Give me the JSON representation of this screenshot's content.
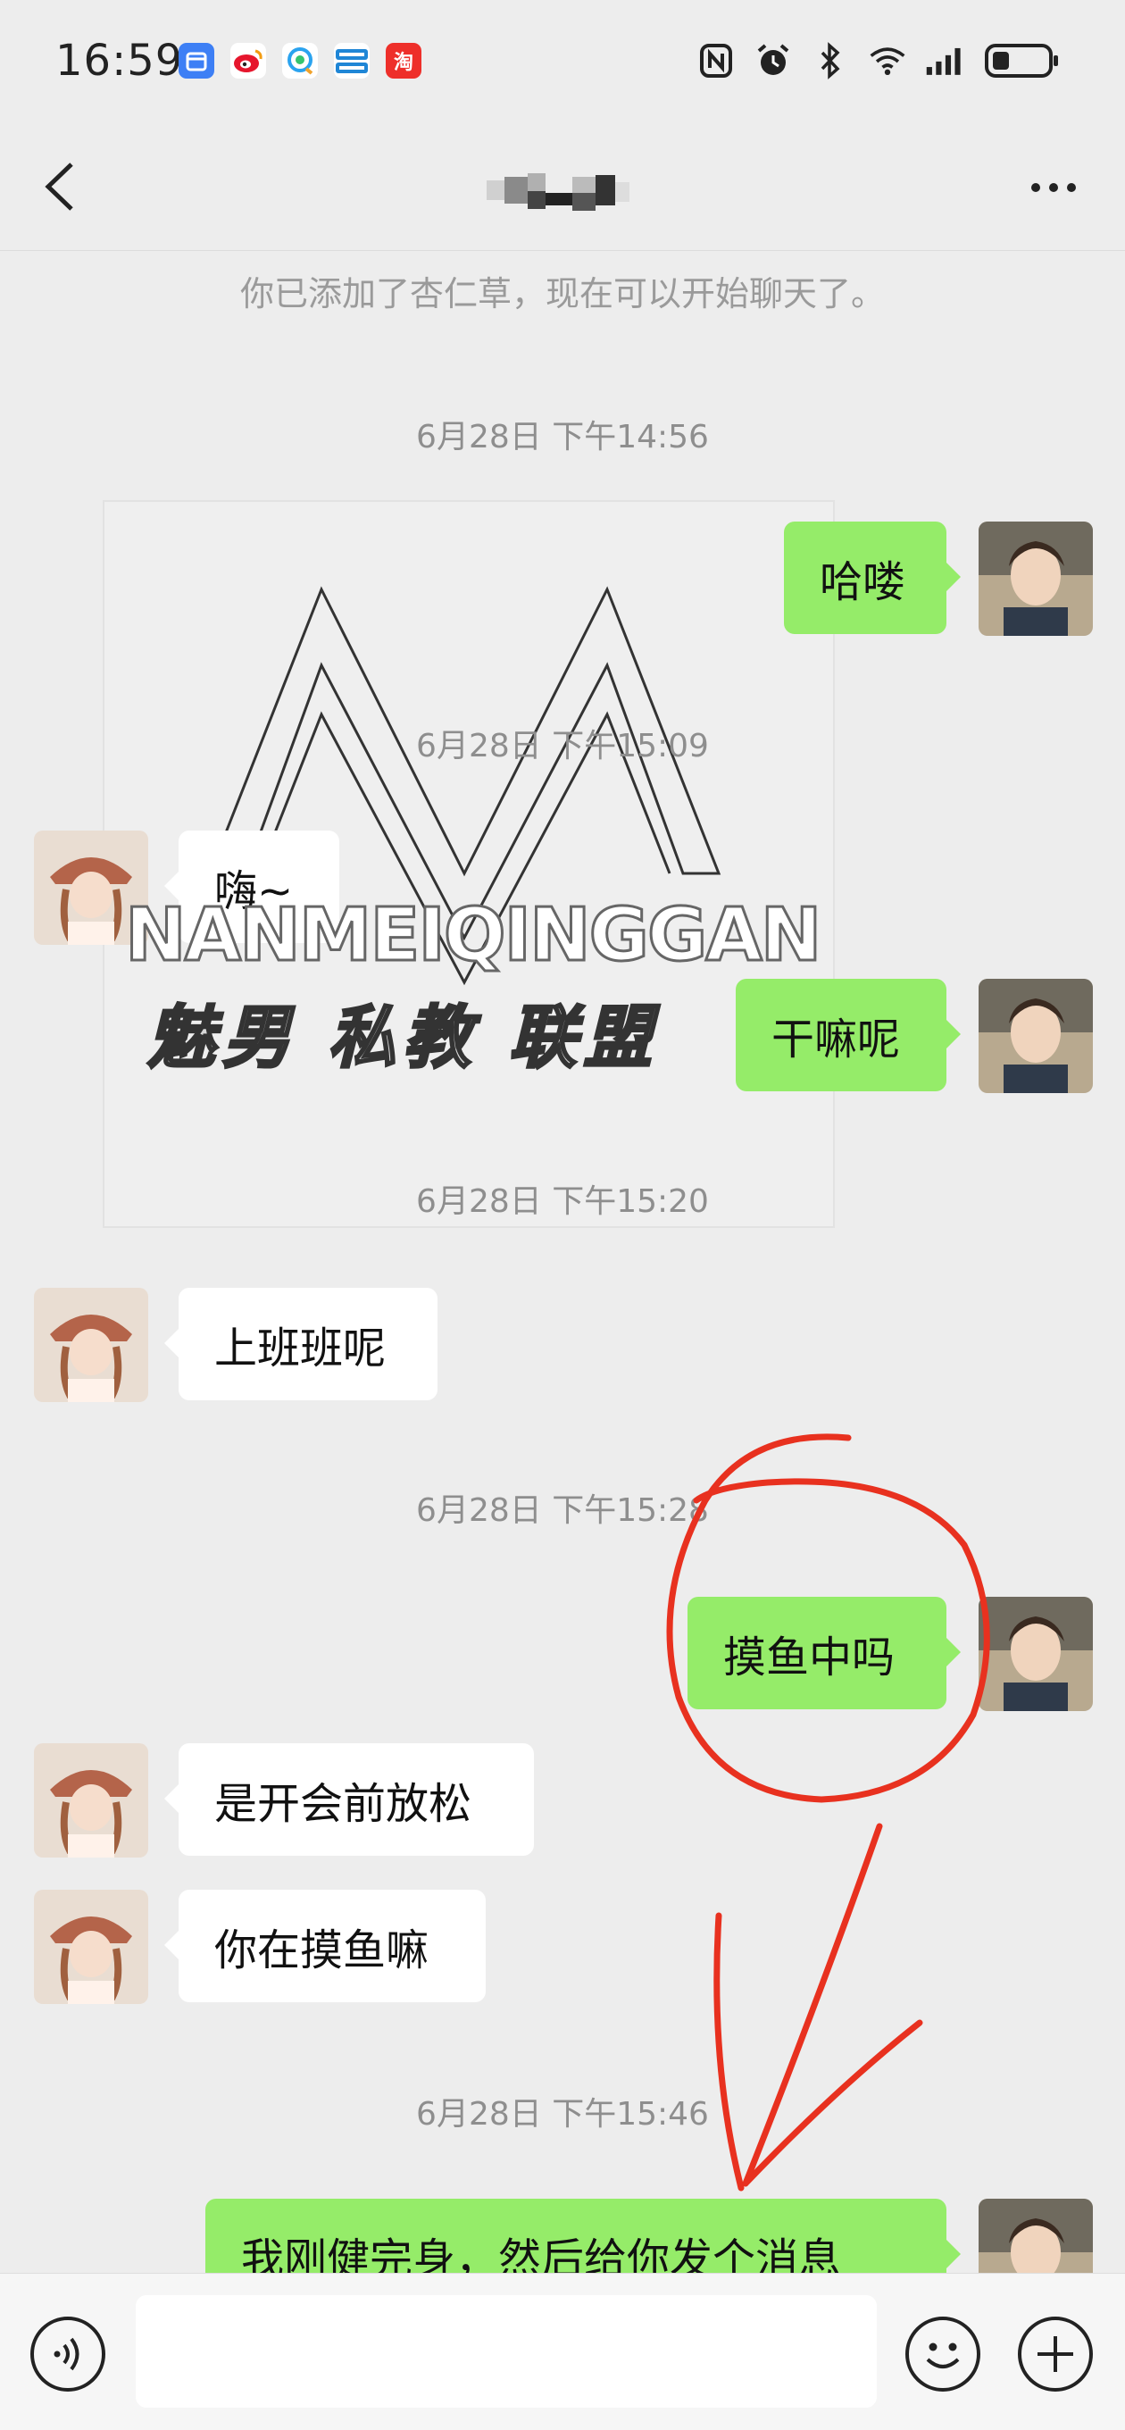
{
  "status_bar": {
    "time": "16:59",
    "app_icons": [
      "calendar-icon",
      "weibo-icon",
      "qq-browser-icon",
      "news-app-icon",
      "taobao-icon"
    ],
    "taobao_label": "淘",
    "system_icons": [
      "nfc-icon",
      "alarm-icon",
      "bluetooth-icon",
      "wifi-icon",
      "signal-icon",
      "battery-icon"
    ]
  },
  "header": {
    "back_icon": "chevron-left-icon",
    "title": "",
    "more_icon": "more-dots-icon"
  },
  "chat": {
    "system_notice": "你已添加了杏仁草，现在可以开始聊天了。",
    "timestamps": [
      "6月28日 下午14:56",
      "6月28日 下午15:09",
      "6月28日 下午15:20",
      "6月28日 下午15:28",
      "6月28日 下午15:46"
    ],
    "messages": [
      {
        "side": "out",
        "text": "哈喽"
      },
      {
        "side": "in",
        "text": "嗨~"
      },
      {
        "side": "out",
        "text": "干嘛呢"
      },
      {
        "side": "in",
        "text": "上班班呢"
      },
      {
        "side": "out",
        "text": "摸鱼中吗"
      },
      {
        "side": "in",
        "text": "是开会前放松"
      },
      {
        "side": "in",
        "text": "你在摸鱼嘛"
      },
      {
        "side": "out",
        "text": "我刚健完身，然后给你发个消息"
      }
    ]
  },
  "watermark": {
    "latin": "NANMEIQINGGAN",
    "chinese": "魅男 私教 联盟"
  },
  "input_bar": {
    "voice_icon": "voice-icon",
    "placeholder": "",
    "emoji_icon": "emoji-icon",
    "plus_icon": "plus-icon"
  },
  "colors": {
    "background": "#ededed",
    "outgoing_bubble": "#95ec69",
    "incoming_bubble": "#ffffff",
    "annotation": "#e8311f"
  }
}
